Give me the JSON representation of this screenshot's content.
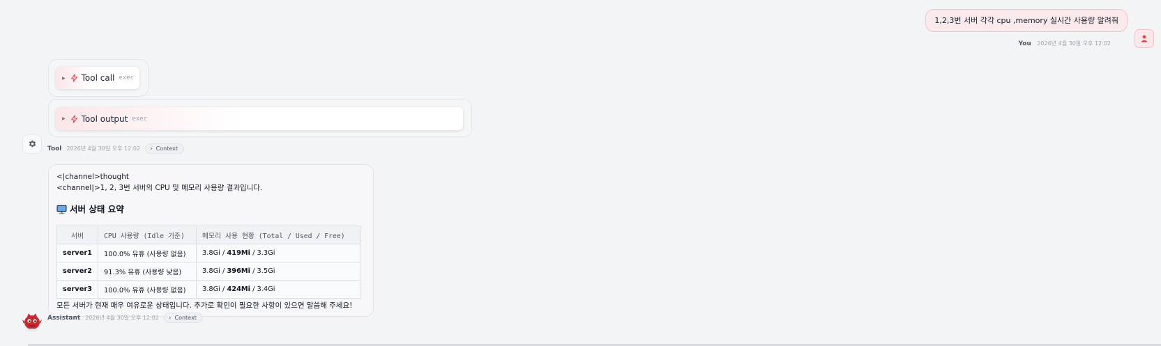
{
  "user": {
    "message": "1,2,3번 서버 각각 cpu ,memory 실시간 사용량 알려줘",
    "name": "You",
    "timestamp": "2026년 4월 30일 오후 12:02",
    "avatar_icon": "person-icon"
  },
  "tool": {
    "call": {
      "label": "Tool call",
      "sub": "exec",
      "icon": "bolt-icon"
    },
    "output": {
      "label": "Tool output",
      "sub": "exec",
      "icon": "bolt-icon"
    },
    "meta": {
      "name": "Tool",
      "timestamp": "2026년 4월 30일 오후 12:02",
      "context_label": "Context"
    },
    "avatar_icon": "gear-icon"
  },
  "assistant": {
    "line1": "<|channel>thought",
    "line2": "<channel|>1, 2, 3번 서버의 CPU 및 메모리 사용량 결과입니다.",
    "heading": "서버 상태 요약",
    "heading_icon": "monitor-icon",
    "table": {
      "headers": [
        "서버",
        "CPU 사용량 (Idle 기준)",
        "메모리 사용 현황 (Total / Used / Free)"
      ],
      "rows": [
        {
          "server": "server1",
          "cpu": "100.0% 유휴 (사용량 없음)",
          "total": "3.8Gi",
          "used": "419Mi",
          "free": "3.3Gi"
        },
        {
          "server": "server2",
          "cpu": "91.3% 유휴 (사용량 낮음)",
          "total": "3.8Gi",
          "used": "396Mi",
          "free": "3.5Gi"
        },
        {
          "server": "server3",
          "cpu": "100.0% 유휴 (사용량 없음)",
          "total": "3.8Gi",
          "used": "424Mi",
          "free": "3.4Gi"
        }
      ]
    },
    "footer": "모든 서버가 현재 매우 여유로운 상태입니다. 추가로 확인이 필요한 사항이 있으면 말씀해 주세요!",
    "meta": {
      "name": "Assistant",
      "timestamp": "2026년 4월 30일 오후 12:02",
      "context_label": "Context"
    },
    "avatar_icon": "red-bot-avatar-icon"
  },
  "colors": {
    "accent": "#e0454f",
    "bubble_user": "#fbeaec",
    "background": "#f3f4f6"
  }
}
